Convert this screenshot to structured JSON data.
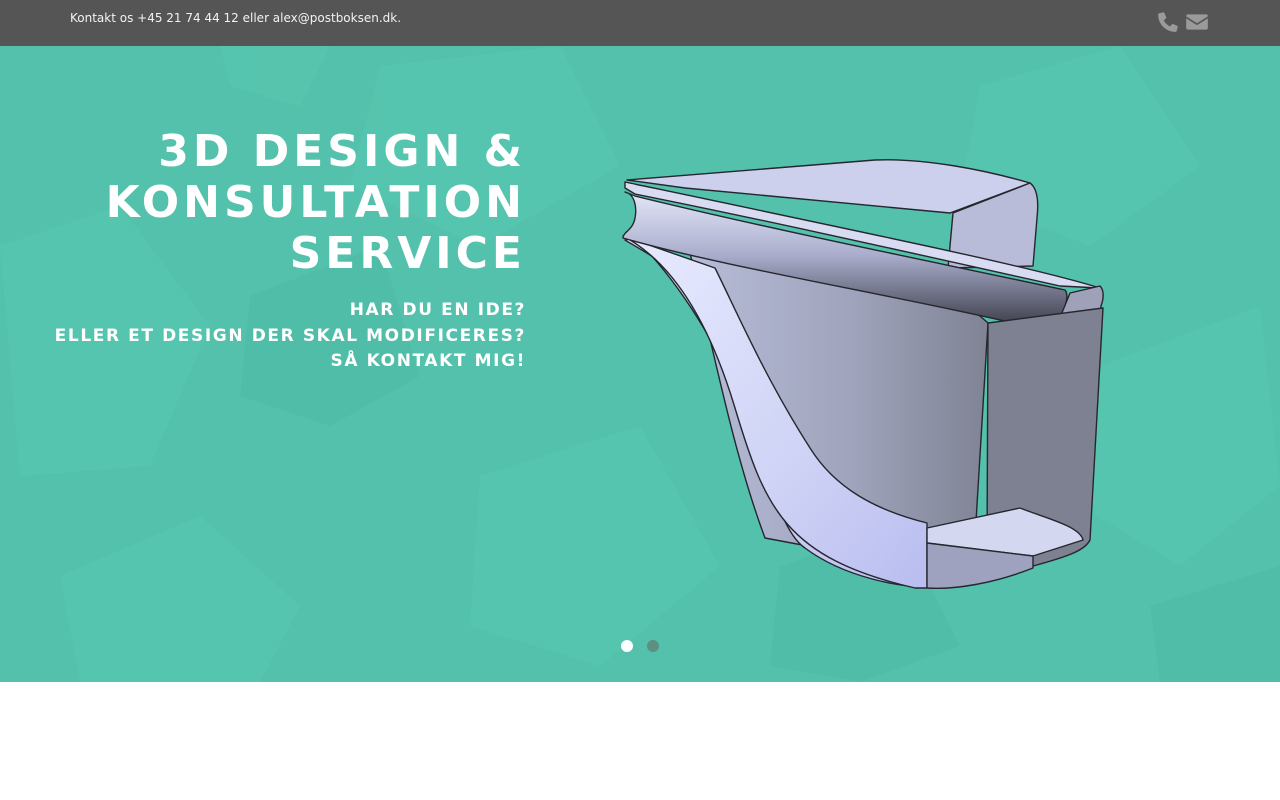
{
  "topbar": {
    "contact_text": "Kontakt os +45 21 74 44 12 eller alex@postboksen.dk.",
    "icons": [
      "phone-icon",
      "envelope-icon"
    ],
    "background": "#555555"
  },
  "hero": {
    "background": "#53c1ab",
    "title_lines": [
      "3D DESIGN &",
      "KONSULTATION",
      "SERVICE"
    ],
    "subtitle_lines": [
      "HAR DU EN IDE?",
      "ELLER ET DESIGN DER SKAL MODIFICERES?",
      "SÅ KONTAKT MIG!"
    ],
    "slider": {
      "slide_count": 2,
      "active_index": 0
    }
  }
}
